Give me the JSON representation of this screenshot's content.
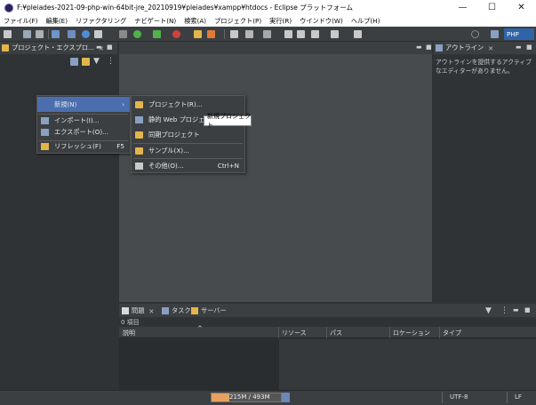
{
  "window": {
    "title": "F:¥pleiades-2021-09-php-win-64bit-jre_20210919¥pleiades¥xampp¥htdocs - Eclipse プラットフォーム",
    "minimize": "—",
    "maximize": "☐",
    "close": "✕"
  },
  "menubar": [
    "ファイル(F)",
    "編集(E)",
    "リファクタリング",
    "ナビゲート(N)",
    "検索(A)",
    "プロジェクト(P)",
    "実行(R)",
    "ウインドウ(W)",
    "ヘルプ(H)"
  ],
  "toolbar": {
    "perspective": "PHP",
    "search_icon": "search-icon"
  },
  "left_pane": {
    "tab": "プロジェクト・エクスプロ...",
    "close": "✕"
  },
  "outline": {
    "tab": "アウトライン",
    "close": "✕",
    "message": "アウトラインを提供するアクティブなエディターがありません。"
  },
  "context_menu": {
    "items": [
      {
        "label": "新規(N)",
        "accel": "›"
      },
      {
        "label": "インポート(I)...",
        "accel": ""
      },
      {
        "label": "エクスポート(O)...",
        "accel": ""
      },
      {
        "label": "リフレッシュ(F)",
        "accel": "F5"
      }
    ]
  },
  "submenu": {
    "items": [
      {
        "label": "プロジェクト(R)...",
        "accel": ""
      },
      {
        "label": "静的 Web プロジェクト",
        "accel": ""
      },
      {
        "label": "同期プロジェクト",
        "accel": ""
      },
      {
        "label": "サンプル(X)...",
        "accel": ""
      },
      {
        "label": "その他(O)...",
        "accel": "Ctrl+N"
      }
    ],
    "tooltip": "新規プロジェクト"
  },
  "bottom": {
    "tabs": [
      {
        "label": "問題",
        "close": "✕"
      },
      {
        "label": "タスク"
      },
      {
        "label": "サーバー"
      }
    ],
    "items_count": "0 項目",
    "columns": [
      "説明",
      "リソース",
      "パス",
      "ロケーション",
      "タイプ"
    ],
    "sort_indicator": "^"
  },
  "statusbar": {
    "heap": "215M / 493M",
    "encoding": "UTF-8",
    "line_ending": "LF"
  },
  "colors": {
    "accent": "#4b6eaf",
    "perspective": "#2f65a8",
    "folder": "#e3b54a"
  }
}
